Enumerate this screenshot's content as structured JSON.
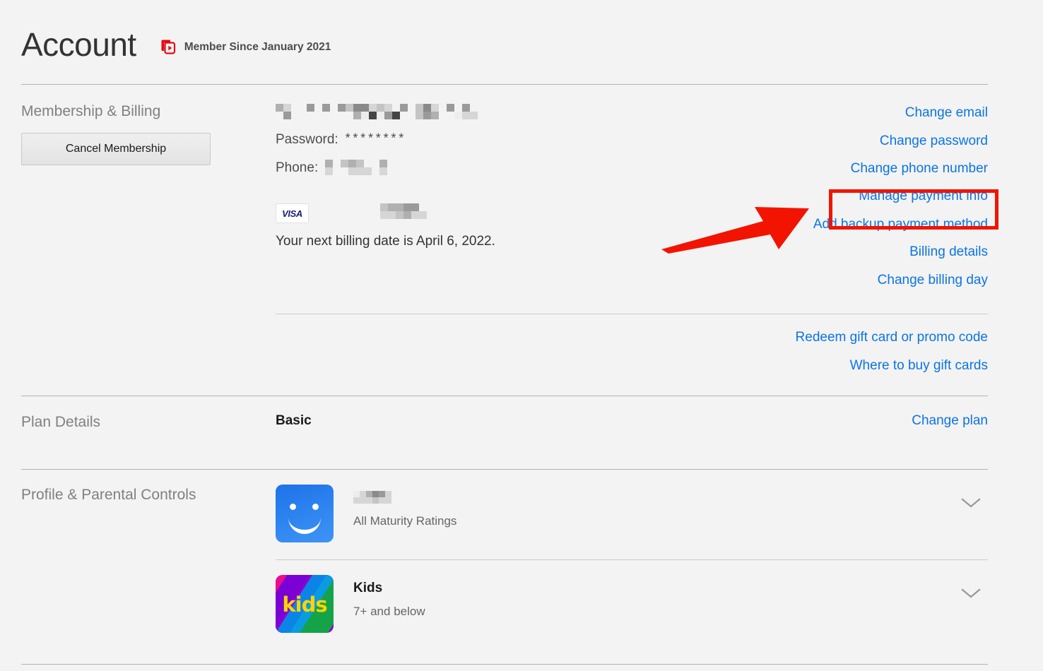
{
  "header": {
    "title": "Account",
    "member_icon": "netflix-profile-cards-icon",
    "member_since": "Member Since January 2021"
  },
  "membership": {
    "section_label": "Membership & Billing",
    "cancel_label": "Cancel Membership",
    "email_redacted": "",
    "password_label": "Password:",
    "password_value": "********",
    "phone_label": "Phone:",
    "phone_redacted": "",
    "card_brand": "VISA",
    "card_number_redacted": "",
    "billing_date": "Your next billing date is April 6, 2022.",
    "links": [
      {
        "label": "Change email",
        "name": "change-email-link"
      },
      {
        "label": "Change password",
        "name": "change-password-link"
      },
      {
        "label": "Change phone number",
        "name": "change-phone-number-link"
      }
    ],
    "payment_links": [
      {
        "label": "Manage payment info",
        "name": "manage-payment-info-link"
      },
      {
        "label": "Add backup payment method",
        "name": "add-backup-payment-method-link"
      },
      {
        "label": "Billing details",
        "name": "billing-details-link"
      },
      {
        "label": "Change billing day",
        "name": "change-billing-day-link"
      }
    ],
    "gift_links": [
      {
        "label": "Redeem gift card or promo code",
        "name": "redeem-gift-card-link"
      },
      {
        "label": "Where to buy gift cards",
        "name": "where-to-buy-gift-cards-link"
      }
    ]
  },
  "plan": {
    "section_label": "Plan Details",
    "value": "Basic",
    "change_label": "Change plan"
  },
  "profiles": {
    "section_label": "Profile & Parental Controls",
    "items": [
      {
        "name_redacted": "",
        "name_text": "",
        "maturity": "All Maturity Ratings",
        "avatar": "smiley-blue-avatar",
        "chevron": "chevron-down-icon"
      },
      {
        "name_redacted": null,
        "name_text": "Kids",
        "maturity": "7+ and below",
        "avatar": "kids-avatar",
        "chevron": "chevron-down-icon"
      }
    ]
  },
  "annotation": {
    "highlight_target": "Manage payment info",
    "box_color": "#f21400",
    "arrow_color": "#f21400",
    "arrow": "pointer-arrow"
  },
  "colors": {
    "background": "#f3f3f3",
    "link_blue": "#0b74e5",
    "brand_red": "#e50914",
    "text_dark": "#333333",
    "text_muted": "#808080"
  }
}
